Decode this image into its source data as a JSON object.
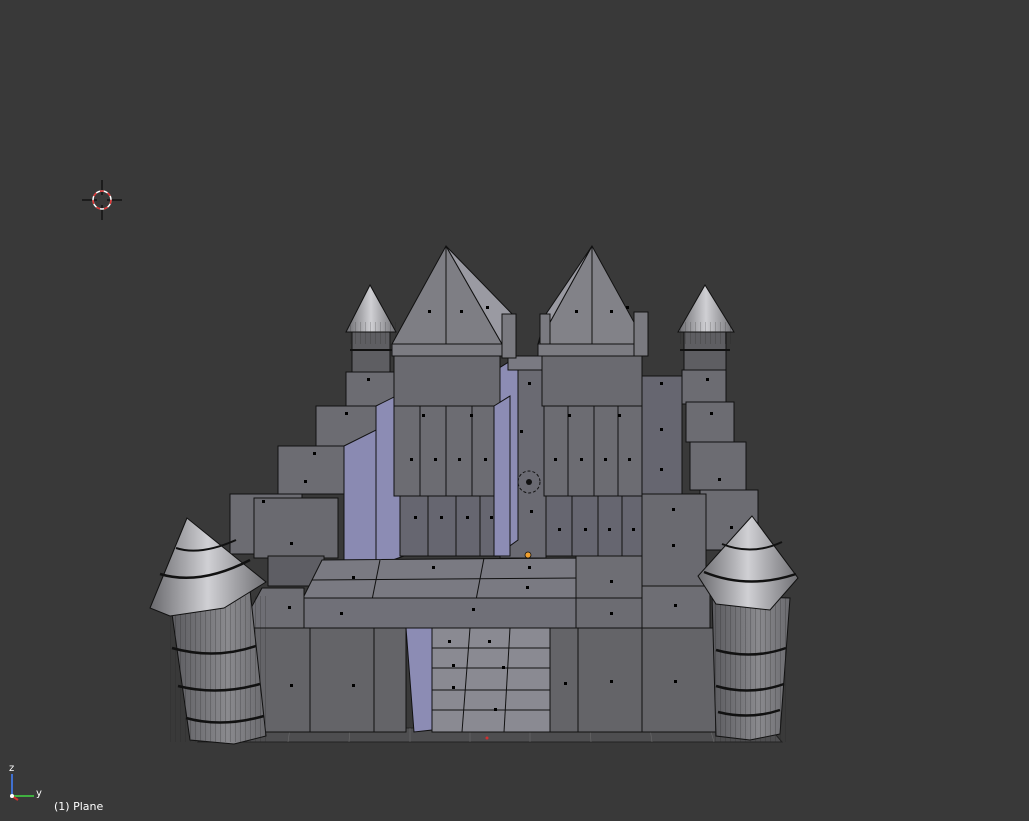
{
  "viewport": {
    "background": "#393939",
    "object_label": "(1) Plane",
    "selected_object": "Plane"
  },
  "axis_gizmo": {
    "x_color": "#d03030",
    "y_color": "#40b040",
    "z_color": "#4070d0",
    "y_label": "y",
    "z_label": "z"
  },
  "model": {
    "face_color": "#6e6e75",
    "face_light": "#8a8a93",
    "face_dark": "#5a5a60",
    "lavender_face": "#8c8cb4",
    "edge_color": "#000000",
    "vertex_color": "#000000",
    "origin_color": "#f0a030"
  },
  "cursor": {
    "name": "3d-cursor",
    "ring_color_a": "#ffffff",
    "ring_color_b": "#e03030"
  }
}
